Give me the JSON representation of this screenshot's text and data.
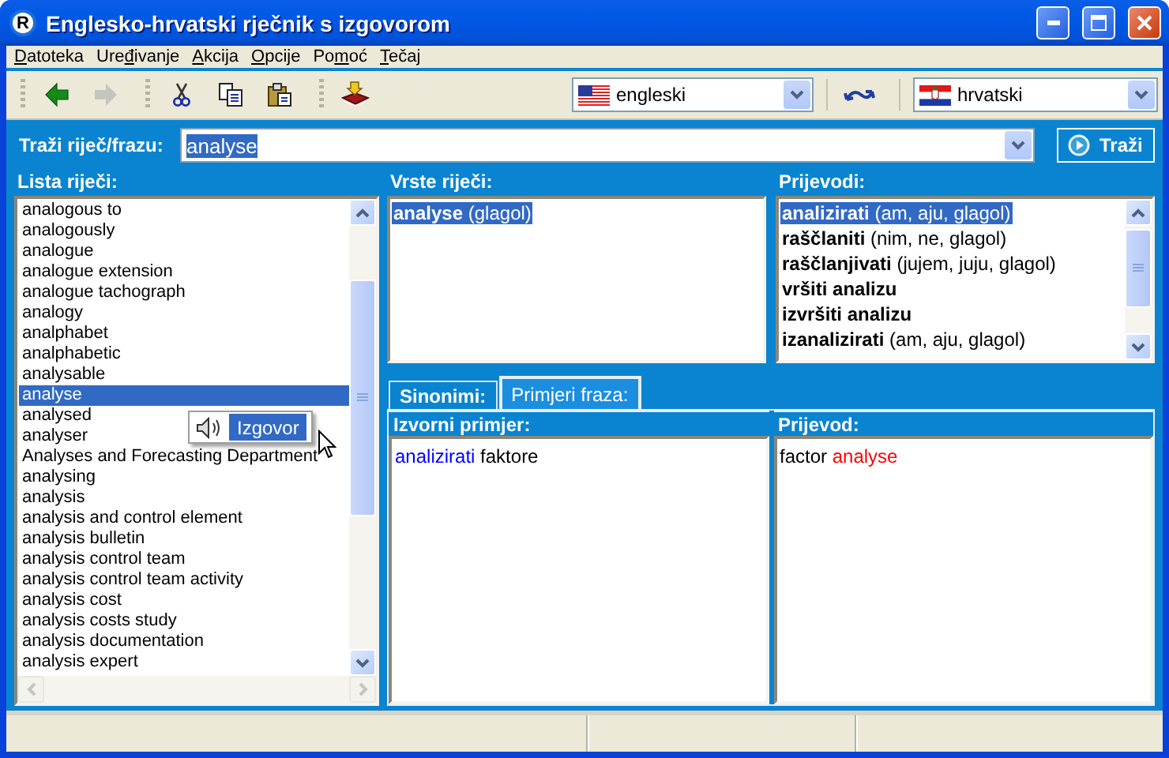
{
  "window": {
    "icon_letter": "R",
    "title": "Englesko-hrvatski rječnik s izgovorom"
  },
  "menu": [
    {
      "key": "D",
      "after": "atoteka"
    },
    {
      "before": "Ure",
      "key": "đ",
      "after": "ivanje"
    },
    {
      "key": "A",
      "after": "kcija"
    },
    {
      "key": "O",
      "after": "pcije"
    },
    {
      "before": "Po",
      "key": "m",
      "after": "oć"
    },
    {
      "key": "T",
      "after": "ečaj"
    }
  ],
  "toolbar": [
    [
      {
        "kind": "back",
        "disabled": false
      },
      {
        "kind": "forward",
        "disabled": true
      }
    ],
    [
      {
        "kind": "cut",
        "disabled": false
      },
      {
        "kind": "copy",
        "disabled": false
      },
      {
        "kind": "paste",
        "disabled": false
      }
    ],
    [
      {
        "kind": "install",
        "disabled": false
      }
    ]
  ],
  "languages": {
    "source": {
      "value": "engleski"
    },
    "target": {
      "value": "hrvatski"
    }
  },
  "search": {
    "label": "Traži riječ/frazu:",
    "value": "analyse",
    "highlighted": true,
    "button": "Traži"
  },
  "word_list": {
    "label": "Lista riječi:",
    "items": [
      {
        "text": "analogous to",
        "selected": false
      },
      {
        "text": "analogously",
        "selected": false
      },
      {
        "text": "analogue",
        "selected": false
      },
      {
        "text": "analogue extension",
        "selected": false
      },
      {
        "text": "analogue tachograph",
        "selected": false
      },
      {
        "text": "analogy",
        "selected": false
      },
      {
        "text": "analphabet",
        "selected": false
      },
      {
        "text": "analphabetic",
        "selected": false
      },
      {
        "text": "analysable",
        "selected": false
      },
      {
        "text": "analyse",
        "selected": true
      },
      {
        "text": "analysed",
        "selected": false
      },
      {
        "text": "analyser",
        "selected": false
      },
      {
        "text": "Analyses and Forecasting Department",
        "selected": false
      },
      {
        "text": "analysing",
        "selected": false
      },
      {
        "text": "analysis",
        "selected": false
      },
      {
        "text": "analysis and control element",
        "selected": false
      },
      {
        "text": "analysis bulletin",
        "selected": false
      },
      {
        "text": "analysis control team",
        "selected": false
      },
      {
        "text": "analysis control team activity",
        "selected": false
      },
      {
        "text": "analysis cost",
        "selected": false
      },
      {
        "text": "analysis costs study",
        "selected": false
      },
      {
        "text": "analysis documentation",
        "selected": false
      },
      {
        "text": "analysis expert",
        "selected": false
      }
    ],
    "popup": {
      "label": "Izgovor"
    }
  },
  "word_types": {
    "label": "Vrste riječi:",
    "items": [
      {
        "word": "analyse",
        "grammar": "(glagol)",
        "selected": true
      }
    ]
  },
  "translations": {
    "label": "Prijevodi:",
    "items": [
      {
        "word": "analizirati",
        "grammar": "(am, aju, glagol)",
        "selected": true
      },
      {
        "word": "raščlaniti",
        "grammar": "(nim, ne, glagol)",
        "selected": false
      },
      {
        "word": "raščlanjivati",
        "grammar": "(jujem, juju, glagol)",
        "selected": false
      },
      {
        "word": "vršiti analizu",
        "selected": false
      },
      {
        "word": "izvršiti analizu",
        "selected": false
      },
      {
        "word": "izanalizirati",
        "grammar": "(am, aju, glagol)",
        "selected": false
      }
    ]
  },
  "tabs": [
    {
      "label": "Sinonimi:",
      "selected": false
    },
    {
      "label": "Primjeri fraza:",
      "selected": true
    }
  ],
  "examples": {
    "columns": [
      "Izvorni primjer:",
      "Prijevod:"
    ],
    "rows": [
      {
        "source": [
          {
            "text": "analizirati",
            "kind": "match"
          },
          {
            "text": "faktore",
            "kind": "plain"
          }
        ],
        "translation": [
          {
            "text": "factor",
            "kind": "plain"
          },
          {
            "text": "analyse",
            "kind": "term"
          }
        ]
      }
    ]
  }
}
